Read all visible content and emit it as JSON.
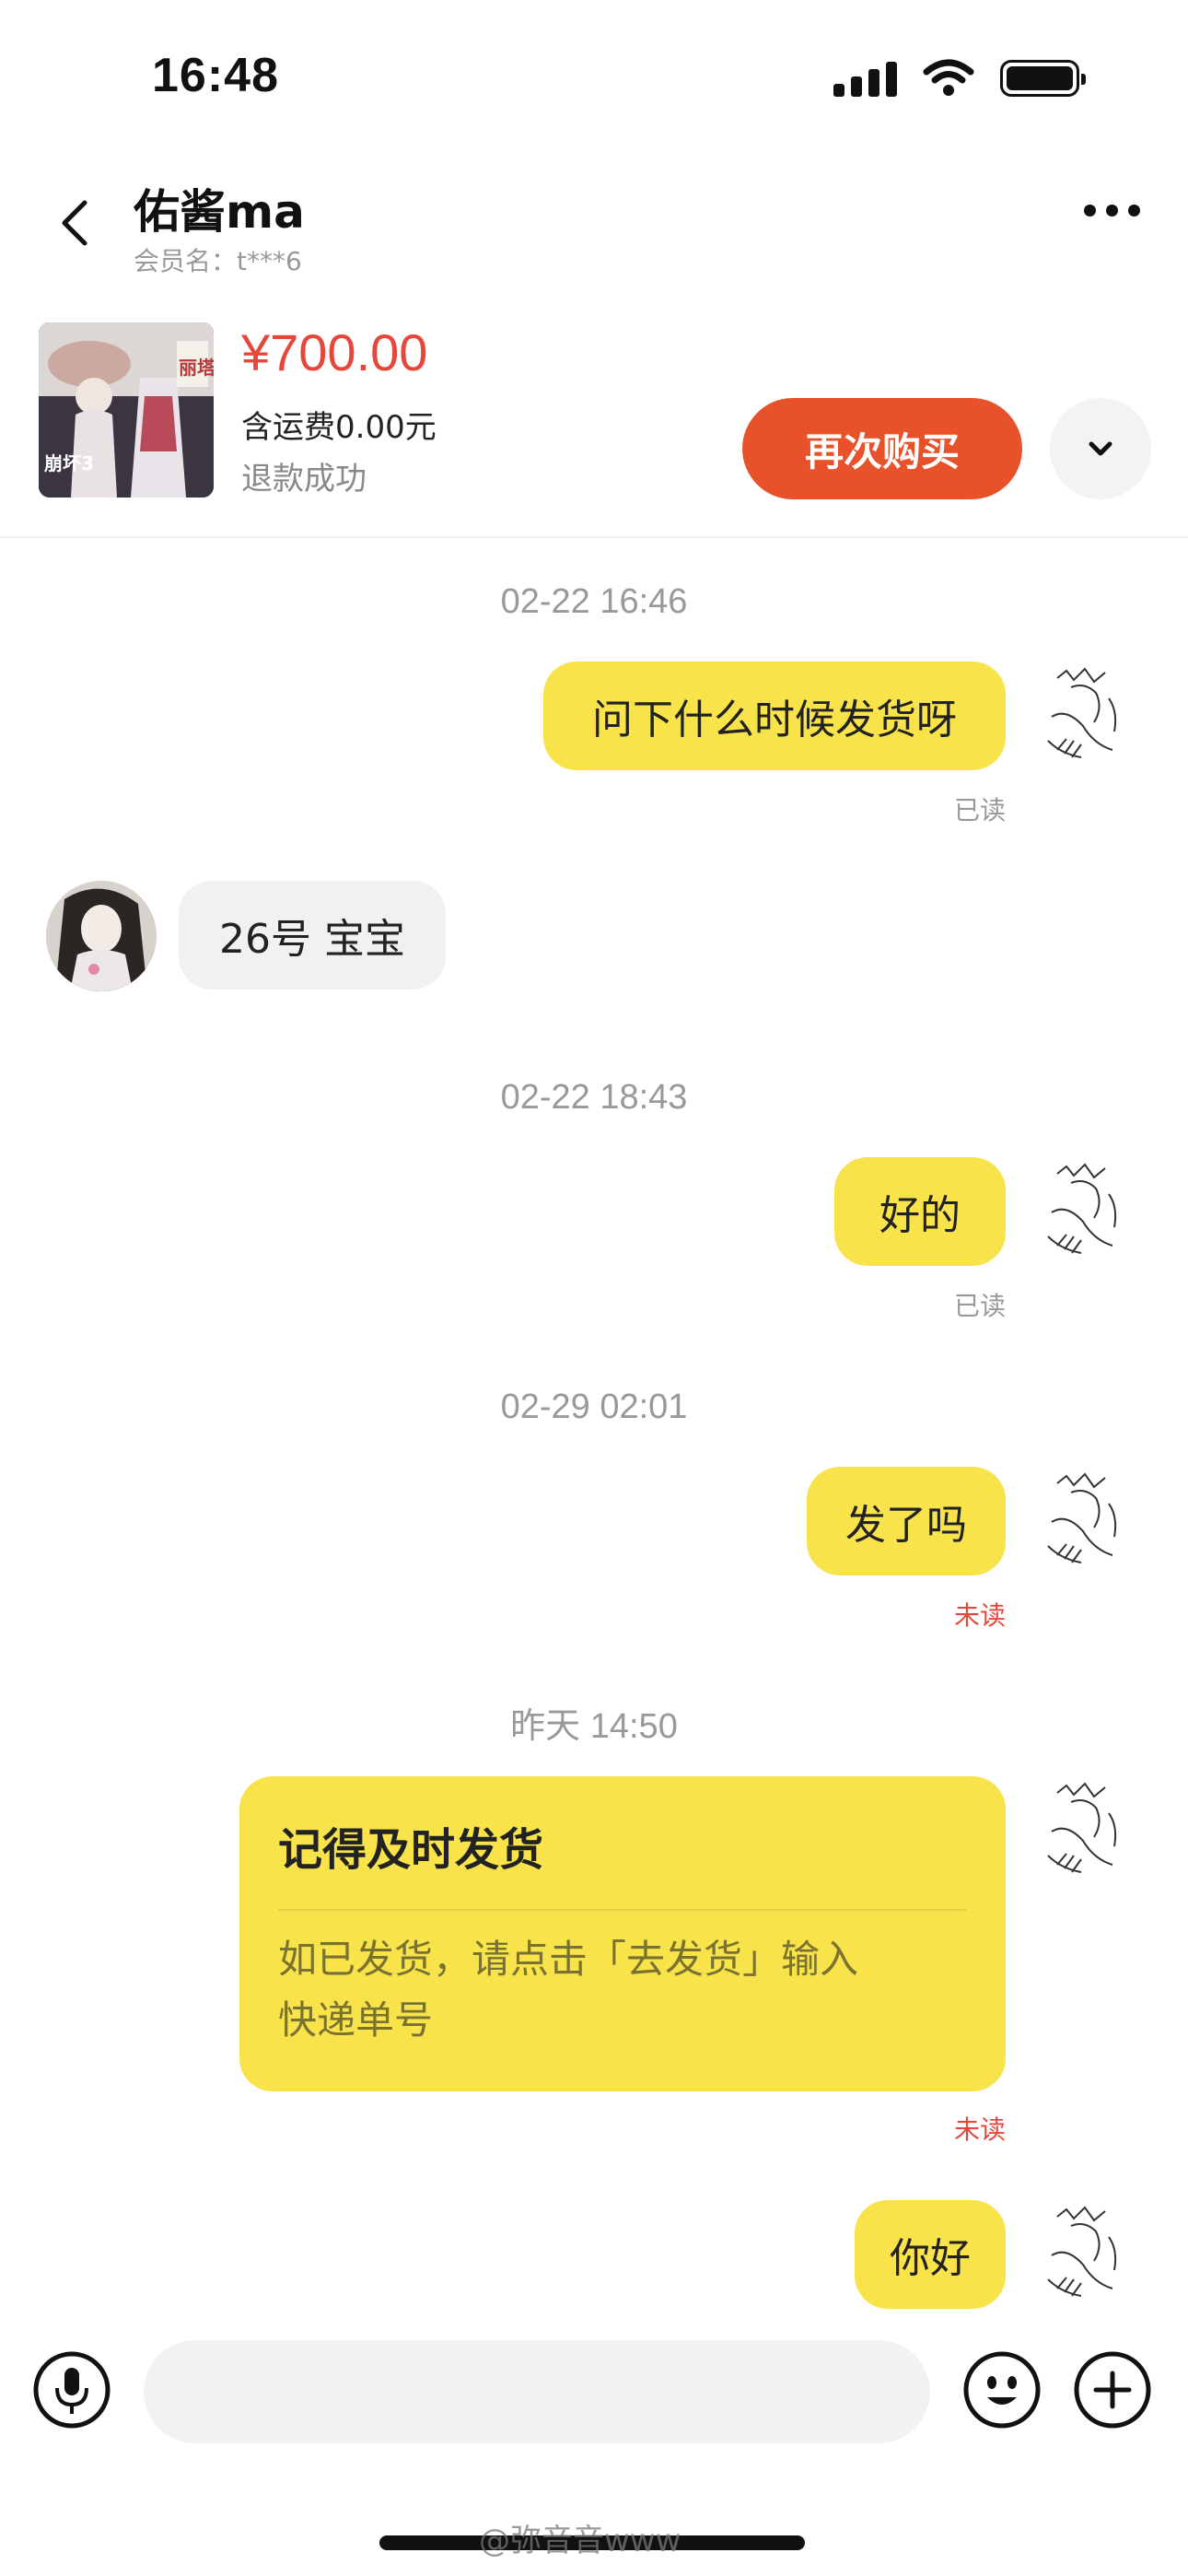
{
  "status_bar": {
    "time": "16:48"
  },
  "header": {
    "title": "佑酱ma",
    "subtitle": "会员名：t***6"
  },
  "product": {
    "price": "¥700.00",
    "shipping": "含运费0.00元",
    "status": "退款成功",
    "buy_again": "再次购买",
    "thumbnail_text": [
      "丽塔",
      "崩坏3"
    ]
  },
  "messages": {
    "ts1": "02-22 16:46",
    "m1": "问下什么时候发货呀",
    "m1_status": "已读",
    "m2": "26号 宝宝",
    "ts2": "02-22 18:43",
    "m3": "好的",
    "m3_status": "已读",
    "ts3": "02-29 02:01",
    "m4": "发了吗",
    "m4_status": "未读",
    "ts4": "昨天 14:50",
    "card_title": "记得及时发货",
    "card_body_line1": "如已发货，请点击「去发货」输入",
    "card_body_line2": "快递单号",
    "card_status": "未读",
    "m5": "你好"
  },
  "input_bar": {
    "placeholder": ""
  },
  "watermark": "@弥音音www",
  "colors": {
    "accent": "#e8522a",
    "bubble": "#f8e34b",
    "price": "#e5483b",
    "unread": "#e5483b"
  }
}
